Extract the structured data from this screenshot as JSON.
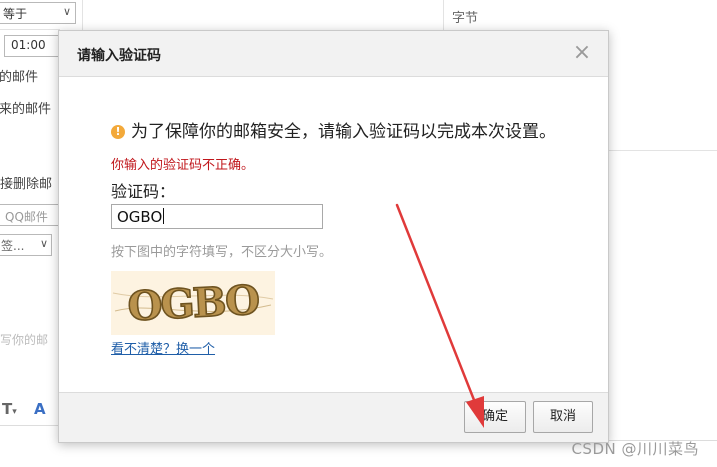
{
  "background": {
    "condition_select": "等于",
    "time_select": "01:00",
    "text_mail_1": "的邮件",
    "text_mail_2": "来的邮件",
    "text_delete": "接删除邮",
    "qq_mail_input": "QQ邮件",
    "sign_select": "签...",
    "compose_placeholder": "写你的邮",
    "right_header": "字节"
  },
  "dialog": {
    "title": "请输入验证码",
    "notice": "为了保障你的邮箱安全，请输入验证码以完成本次设置。",
    "error": "你输入的验证码不正确。",
    "code_label": "验证码：",
    "code_value": "OGBO",
    "hint": "按下图中的字符填写，不区分大小写。",
    "captcha_text": "OGBO",
    "refresh_link": "看不清楚？换一个",
    "ok_label": "确定",
    "cancel_label": "取消"
  },
  "watermark": "CSDN @川川菜鸟",
  "colors": {
    "error": "#c0161b",
    "link": "#1f5ea8",
    "warning_icon": "#f3a93a",
    "annotation_arrow": "#e03a3a"
  }
}
